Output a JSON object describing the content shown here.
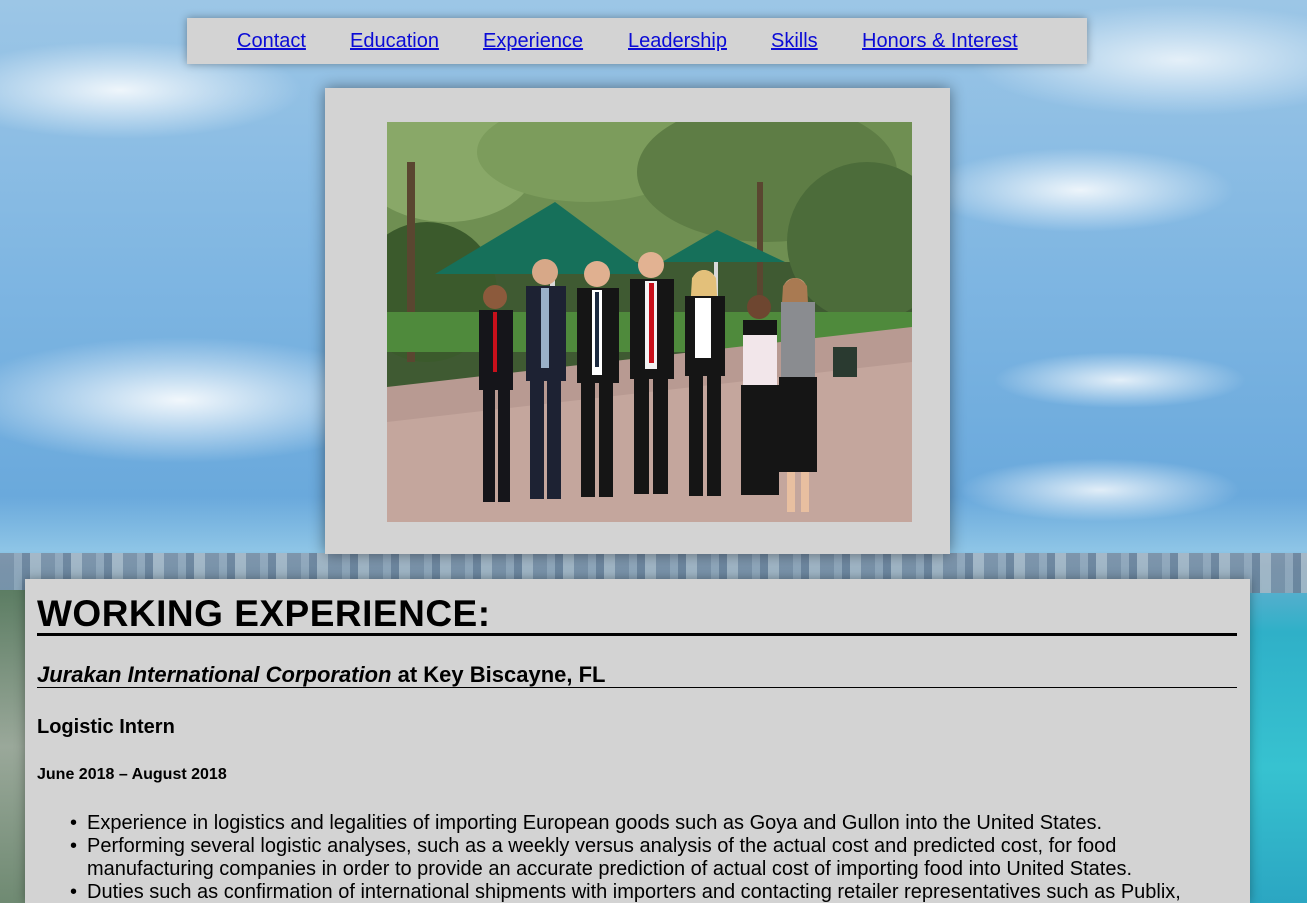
{
  "nav": {
    "items": [
      {
        "label": "Contact"
      },
      {
        "label": "Education"
      },
      {
        "label": "Experience"
      },
      {
        "label": "Leadership"
      },
      {
        "label": "Skills"
      },
      {
        "label": "Honors & Interest"
      }
    ]
  },
  "colors": {
    "link": "#0b0bd6",
    "panel": "#d3d3d3",
    "text": "#000000"
  },
  "photo": {
    "icon": "group-photo"
  },
  "experience": {
    "section_title": "WORKING EXPERIENCE:",
    "company": "Jurakan International Corporation",
    "location": " at Key Biscayne, FL",
    "role": "Logistic Intern",
    "dates": "June 2018 – August 2018",
    "bullets": [
      "Experience in logistics and legalities of importing European goods such as Goya and Gullon into the United States.",
      "Performing several logistic analyses, such as a weekly versus analysis of the actual cost and predicted cost, for food manufacturing companies in order to provide an accurate prediction of actual cost of importing food into United States.",
      "Duties such as confirmation of international shipments with importers and contacting retailer representatives such as Publix,"
    ]
  }
}
